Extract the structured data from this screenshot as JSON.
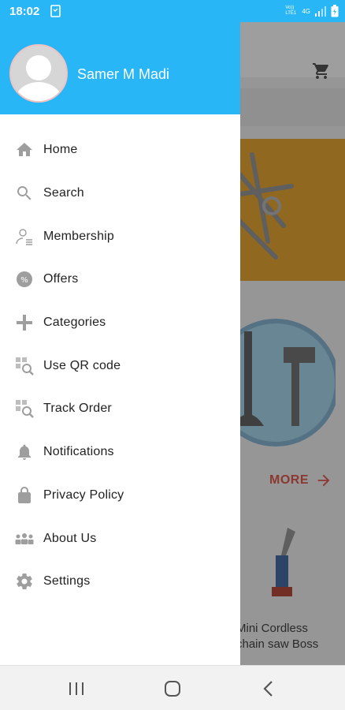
{
  "status_bar": {
    "time": "18:02",
    "network_label": "Vo)) LTE1",
    "network_type": "4G"
  },
  "drawer": {
    "user_name": "Samer M Madi",
    "header_color": "#29b6f6",
    "menu": [
      {
        "label": "Home",
        "icon": "home-icon"
      },
      {
        "label": "Search",
        "icon": "search-icon"
      },
      {
        "label": "Membership",
        "icon": "membership-icon"
      },
      {
        "label": "Offers",
        "icon": "offers-icon"
      },
      {
        "label": "Categories",
        "icon": "categories-icon"
      },
      {
        "label": "Use QR code",
        "icon": "qr-code-icon"
      },
      {
        "label": "Track Order",
        "icon": "track-order-icon"
      },
      {
        "label": "Notifications",
        "icon": "bell-icon"
      },
      {
        "label": "Privacy Policy",
        "icon": "lock-icon"
      },
      {
        "label": "About Us",
        "icon": "group-icon"
      },
      {
        "label": "Settings",
        "icon": "gear-icon"
      }
    ]
  },
  "background": {
    "more_label": "MORE",
    "product_name": "Mini Cordless\nchain saw Boss",
    "accent_color": "#e05b4f"
  },
  "nav_bar": {
    "buttons": [
      "recents-icon",
      "home-button-icon",
      "back-icon"
    ]
  }
}
